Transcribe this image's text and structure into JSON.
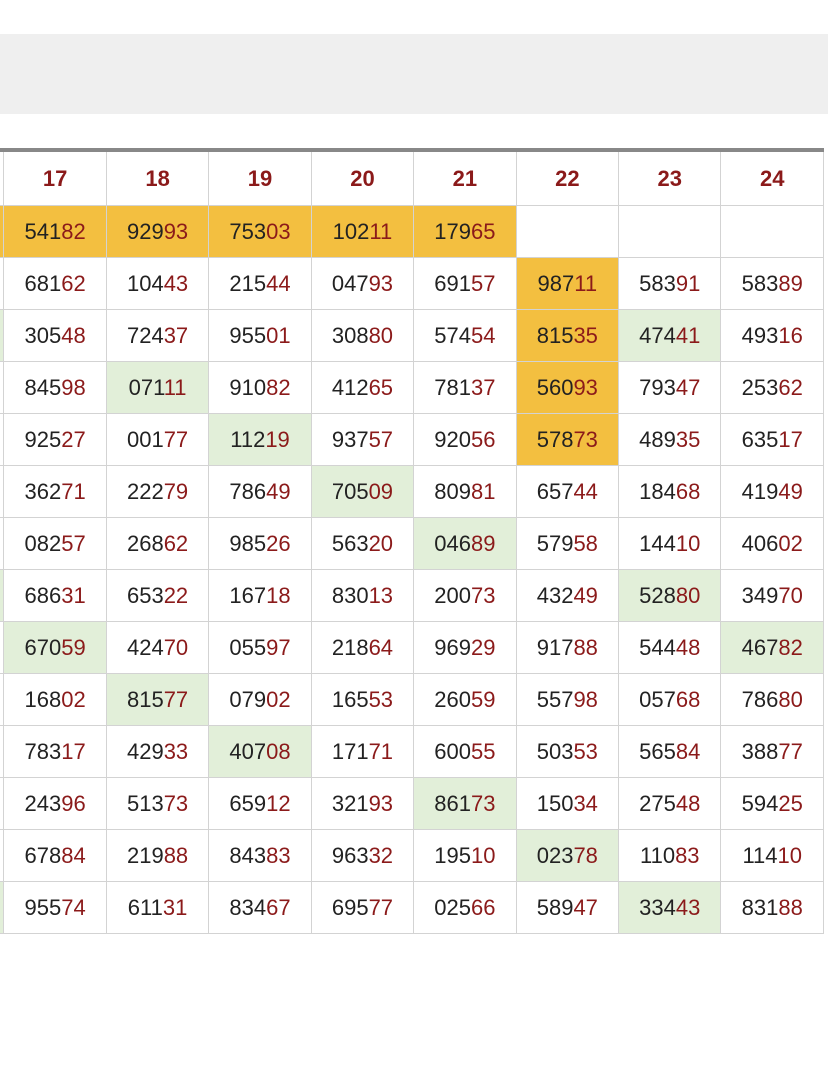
{
  "colors": {
    "header_text": "#8b1a1a",
    "tail_digits": "#8b1a1a",
    "highlight_orange": "#f3bf40",
    "highlight_green": "#e2efd9",
    "top_bar": "#efefef"
  },
  "columns": [
    {
      "label": "",
      "width": 8
    },
    {
      "label": "17",
      "width": 106
    },
    {
      "label": "18",
      "width": 106
    },
    {
      "label": "19",
      "width": 106
    },
    {
      "label": "20",
      "width": 106
    },
    {
      "label": "21",
      "width": 106
    },
    {
      "label": "22",
      "width": 106
    },
    {
      "label": "23",
      "width": 106
    },
    {
      "label": "24",
      "width": 106
    }
  ],
  "rows": [
    {
      "first": "orange",
      "cells": [
        {
          "v": "54182",
          "hl": "orange"
        },
        {
          "v": "92993",
          "hl": "orange"
        },
        {
          "v": "75303",
          "hl": "orange"
        },
        {
          "v": "10211",
          "hl": "orange"
        },
        {
          "v": "17965",
          "hl": "orange"
        },
        {
          "v": "",
          "hl": ""
        },
        {
          "v": "",
          "hl": ""
        },
        {
          "v": "",
          "hl": ""
        }
      ]
    },
    {
      "first": "",
      "cells": [
        {
          "v": "68162",
          "hl": ""
        },
        {
          "v": "10443",
          "hl": ""
        },
        {
          "v": "21544",
          "hl": ""
        },
        {
          "v": "04793",
          "hl": ""
        },
        {
          "v": "69157",
          "hl": ""
        },
        {
          "v": "98711",
          "hl": "orange"
        },
        {
          "v": "58391",
          "hl": ""
        },
        {
          "v": "58389",
          "hl": ""
        }
      ]
    },
    {
      "first": "green",
      "cells": [
        {
          "v": "30548",
          "hl": ""
        },
        {
          "v": "72437",
          "hl": ""
        },
        {
          "v": "95501",
          "hl": ""
        },
        {
          "v": "30880",
          "hl": ""
        },
        {
          "v": "57454",
          "hl": ""
        },
        {
          "v": "81535",
          "hl": "orange"
        },
        {
          "v": "47441",
          "hl": "green"
        },
        {
          "v": "49316",
          "hl": ""
        }
      ]
    },
    {
      "first": "",
      "cells": [
        {
          "v": "84598",
          "hl": ""
        },
        {
          "v": "07111",
          "hl": "green"
        },
        {
          "v": "91082",
          "hl": ""
        },
        {
          "v": "41265",
          "hl": ""
        },
        {
          "v": "78137",
          "hl": ""
        },
        {
          "v": "56093",
          "hl": "orange"
        },
        {
          "v": "79347",
          "hl": ""
        },
        {
          "v": "25362",
          "hl": ""
        }
      ]
    },
    {
      "first": "",
      "cells": [
        {
          "v": "92527",
          "hl": ""
        },
        {
          "v": "00177",
          "hl": ""
        },
        {
          "v": "11219",
          "hl": "green"
        },
        {
          "v": "93757",
          "hl": ""
        },
        {
          "v": "92056",
          "hl": ""
        },
        {
          "v": "57873",
          "hl": "orange"
        },
        {
          "v": "48935",
          "hl": ""
        },
        {
          "v": "63517",
          "hl": ""
        }
      ]
    },
    {
      "first": "",
      "cells": [
        {
          "v": "36271",
          "hl": ""
        },
        {
          "v": "22279",
          "hl": ""
        },
        {
          "v": "78649",
          "hl": ""
        },
        {
          "v": "70509",
          "hl": "green"
        },
        {
          "v": "80981",
          "hl": ""
        },
        {
          "v": "65744",
          "hl": ""
        },
        {
          "v": "18468",
          "hl": ""
        },
        {
          "v": "41949",
          "hl": ""
        }
      ]
    },
    {
      "first": "",
      "cells": [
        {
          "v": "08257",
          "hl": ""
        },
        {
          "v": "26862",
          "hl": ""
        },
        {
          "v": "98526",
          "hl": ""
        },
        {
          "v": "56320",
          "hl": ""
        },
        {
          "v": "04689",
          "hl": "green"
        },
        {
          "v": "57958",
          "hl": ""
        },
        {
          "v": "14410",
          "hl": ""
        },
        {
          "v": "40602",
          "hl": ""
        }
      ]
    },
    {
      "first": "green",
      "cells": [
        {
          "v": "68631",
          "hl": ""
        },
        {
          "v": "65322",
          "hl": ""
        },
        {
          "v": "16718",
          "hl": ""
        },
        {
          "v": "83013",
          "hl": ""
        },
        {
          "v": "20073",
          "hl": ""
        },
        {
          "v": "43249",
          "hl": ""
        },
        {
          "v": "52880",
          "hl": "green"
        },
        {
          "v": "34970",
          "hl": ""
        }
      ]
    },
    {
      "first": "",
      "cells": [
        {
          "v": "67059",
          "hl": "green"
        },
        {
          "v": "42470",
          "hl": ""
        },
        {
          "v": "05597",
          "hl": ""
        },
        {
          "v": "21864",
          "hl": ""
        },
        {
          "v": "96929",
          "hl": ""
        },
        {
          "v": "91788",
          "hl": ""
        },
        {
          "v": "54448",
          "hl": ""
        },
        {
          "v": "46782",
          "hl": "green"
        }
      ]
    },
    {
      "first": "",
      "cells": [
        {
          "v": "16802",
          "hl": ""
        },
        {
          "v": "81577",
          "hl": "green"
        },
        {
          "v": "07902",
          "hl": ""
        },
        {
          "v": "16553",
          "hl": ""
        },
        {
          "v": "26059",
          "hl": ""
        },
        {
          "v": "55798",
          "hl": ""
        },
        {
          "v": "05768",
          "hl": ""
        },
        {
          "v": "78680",
          "hl": ""
        }
      ]
    },
    {
      "first": "",
      "cells": [
        {
          "v": "78317",
          "hl": ""
        },
        {
          "v": "42933",
          "hl": ""
        },
        {
          "v": "40708",
          "hl": "green"
        },
        {
          "v": "17171",
          "hl": ""
        },
        {
          "v": "60055",
          "hl": ""
        },
        {
          "v": "50353",
          "hl": ""
        },
        {
          "v": "56584",
          "hl": ""
        },
        {
          "v": "38877",
          "hl": ""
        }
      ]
    },
    {
      "first": "",
      "cells": [
        {
          "v": "24396",
          "hl": ""
        },
        {
          "v": "51373",
          "hl": ""
        },
        {
          "v": "65912",
          "hl": ""
        },
        {
          "v": "32193",
          "hl": ""
        },
        {
          "v": "86173",
          "hl": "green"
        },
        {
          "v": "15034",
          "hl": ""
        },
        {
          "v": "27548",
          "hl": ""
        },
        {
          "v": "59425",
          "hl": ""
        }
      ]
    },
    {
      "first": "",
      "cells": [
        {
          "v": "67884",
          "hl": ""
        },
        {
          "v": "21988",
          "hl": ""
        },
        {
          "v": "84383",
          "hl": ""
        },
        {
          "v": "96332",
          "hl": ""
        },
        {
          "v": "19510",
          "hl": ""
        },
        {
          "v": "02378",
          "hl": "green"
        },
        {
          "v": "11083",
          "hl": ""
        },
        {
          "v": "11410",
          "hl": ""
        }
      ]
    },
    {
      "first": "green",
      "cells": [
        {
          "v": "95574",
          "hl": ""
        },
        {
          "v": "61131",
          "hl": ""
        },
        {
          "v": "83467",
          "hl": ""
        },
        {
          "v": "69577",
          "hl": ""
        },
        {
          "v": "02566",
          "hl": ""
        },
        {
          "v": "58947",
          "hl": ""
        },
        {
          "v": "33443",
          "hl": "green"
        },
        {
          "v": "83188",
          "hl": ""
        }
      ]
    }
  ]
}
